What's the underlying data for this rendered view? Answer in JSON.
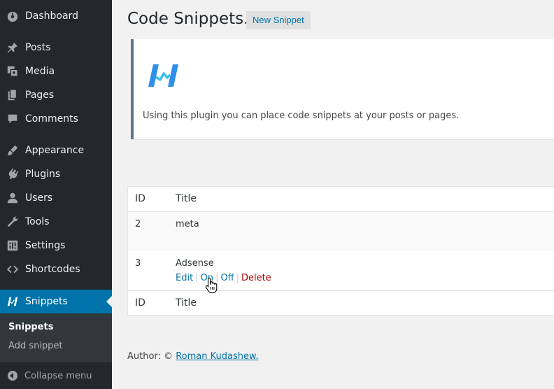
{
  "sidebar": {
    "items": [
      {
        "label": "Dashboard",
        "icon": "dashboard-icon"
      },
      {
        "label": "Posts",
        "icon": "pin-icon"
      },
      {
        "label": "Media",
        "icon": "media-icon"
      },
      {
        "label": "Pages",
        "icon": "pages-icon"
      },
      {
        "label": "Comments",
        "icon": "comment-icon"
      },
      {
        "label": "Appearance",
        "icon": "brush-icon"
      },
      {
        "label": "Plugins",
        "icon": "plug-icon"
      },
      {
        "label": "Users",
        "icon": "user-icon"
      },
      {
        "label": "Tools",
        "icon": "wrench-icon"
      },
      {
        "label": "Settings",
        "icon": "settings-icon"
      },
      {
        "label": "Shortcodes",
        "icon": "code-icon"
      },
      {
        "label": "Snippets",
        "icon": "snippet-icon"
      }
    ],
    "submenu": [
      {
        "label": "Snippets"
      },
      {
        "label": "Add snippet"
      }
    ],
    "collapse_label": "Collapse menu"
  },
  "page": {
    "title": "Code Snippets.",
    "new_button": "New Snippet"
  },
  "notice": {
    "description": "Using this plugin you can place code snippets at your posts or pages."
  },
  "table": {
    "columns": [
      "ID",
      "Title"
    ],
    "rows": [
      {
        "id": "2",
        "title": "meta"
      },
      {
        "id": "3",
        "title": "Adsense",
        "actions": [
          "Edit",
          "On",
          "Off",
          "Delete"
        ]
      }
    ]
  },
  "footer": {
    "author_prefix": "Author: ©",
    "author_link": "Roman Kudashew."
  },
  "colors": {
    "sidebar_bg": "#23282d",
    "active_bg": "#0073aa",
    "link": "#0073aa",
    "delete": "#aa0000"
  }
}
